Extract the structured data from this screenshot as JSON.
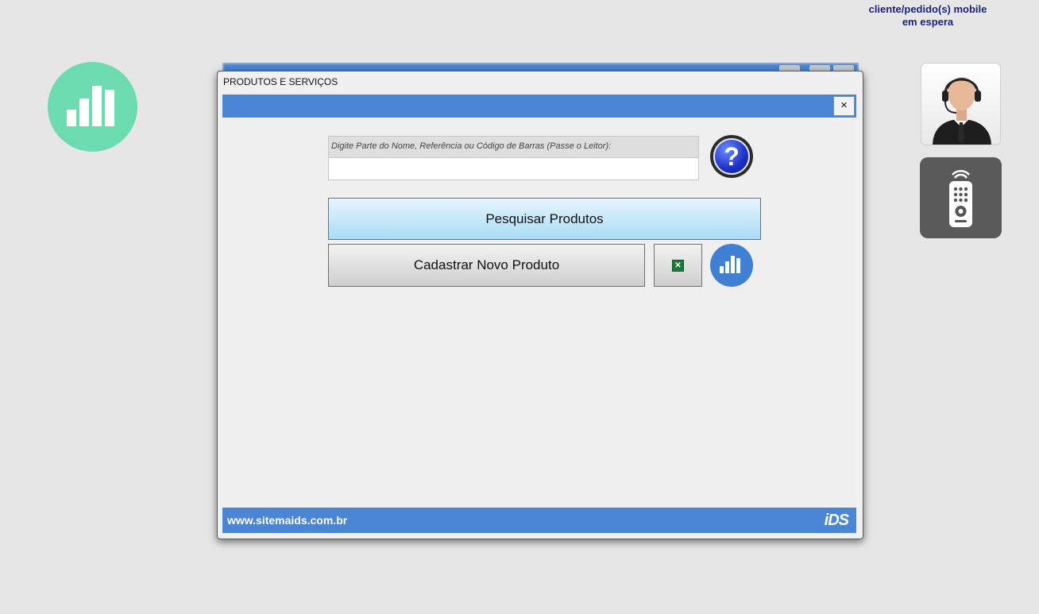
{
  "top_notice": {
    "line1": "cliente/pedido(s) mobile",
    "line2": "em espera"
  },
  "dialog": {
    "title": "PRODUTOS E SERVIÇOS",
    "close_label": "×",
    "search_label": "Digite Parte do Nome, Referência ou Código de Barras (Passe o Leitor):",
    "search_value": "",
    "help_symbol": "?",
    "search_button": "Pesquisar Produtos",
    "register_button": "Cadastrar Novo Produto",
    "excel_symbol": "✕",
    "footer_site": "www.sitemaids.com.br",
    "footer_logo": "iDS"
  },
  "icons": {
    "left_stats": "bar-chart-icon",
    "dialog_chart": "bar-chart-icon",
    "help": "question-icon",
    "excel": "excel-icon",
    "support": "support-agent-icon",
    "remote": "remote-control-icon"
  },
  "colors": {
    "accent_blue": "#4a86d4",
    "stats_green": "#6ddbb0",
    "notice_text": "#1a237e",
    "search_button_top": "#e6f5fd",
    "search_button_bottom": "#a9dcf6"
  }
}
